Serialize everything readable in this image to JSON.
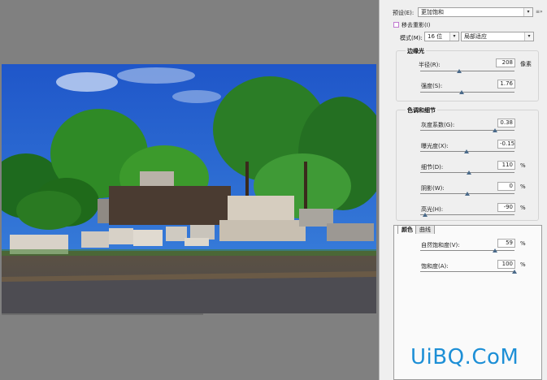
{
  "dialog": {
    "preset_label": "预设(E):",
    "preset_value": "更加饱和",
    "remove_ghost_label": "移去重影(I)",
    "mode_label": "模式(M):",
    "mode_bits": "16 位",
    "mode_method": "局部适应"
  },
  "edge_glow": {
    "title": "边缘光",
    "radius_label": "半径(R):",
    "radius_value": "208",
    "radius_unit": "像素",
    "radius_fraction": 0.41,
    "strength_label": "强度(S):",
    "strength_value": "1.76",
    "strength_fraction": 0.44
  },
  "tone_detail": {
    "title": "色调和细节",
    "gamma_label": "灰度系数(G):",
    "gamma_value": "0.38",
    "gamma_fraction": 0.79,
    "exposure_label": "曝光度(X):",
    "exposure_value": "-0.15",
    "exposure_fraction": 0.49,
    "detail_label": "细节(D):",
    "detail_value": "110",
    "detail_unit": "%",
    "detail_fraction": 0.52,
    "shadow_label": "阴影(W):",
    "shadow_value": "0",
    "shadow_unit": "%",
    "shadow_fraction": 0.5,
    "highlight_label": "高光(H):",
    "highlight_value": "-90",
    "highlight_unit": "%",
    "highlight_fraction": 0.05
  },
  "color_tabs": {
    "tab_color": "颜色",
    "tab_curve": "曲线",
    "vibrance_label": "自然饱和度(V):",
    "vibrance_value": "59",
    "vibrance_unit": "%",
    "vibrance_fraction": 0.79,
    "saturation_label": "饱和度(A):",
    "saturation_value": "100",
    "saturation_unit": "%",
    "saturation_fraction": 1.0
  },
  "watermark": "UiBQ.CoM",
  "icons": {
    "preset_menu": "menu-icon",
    "mode_arrow": "chevron-down-icon"
  },
  "colors": {
    "panel_bg": "#efefef",
    "preview_bg": "#808080",
    "watermark": "#1d8fd6"
  }
}
